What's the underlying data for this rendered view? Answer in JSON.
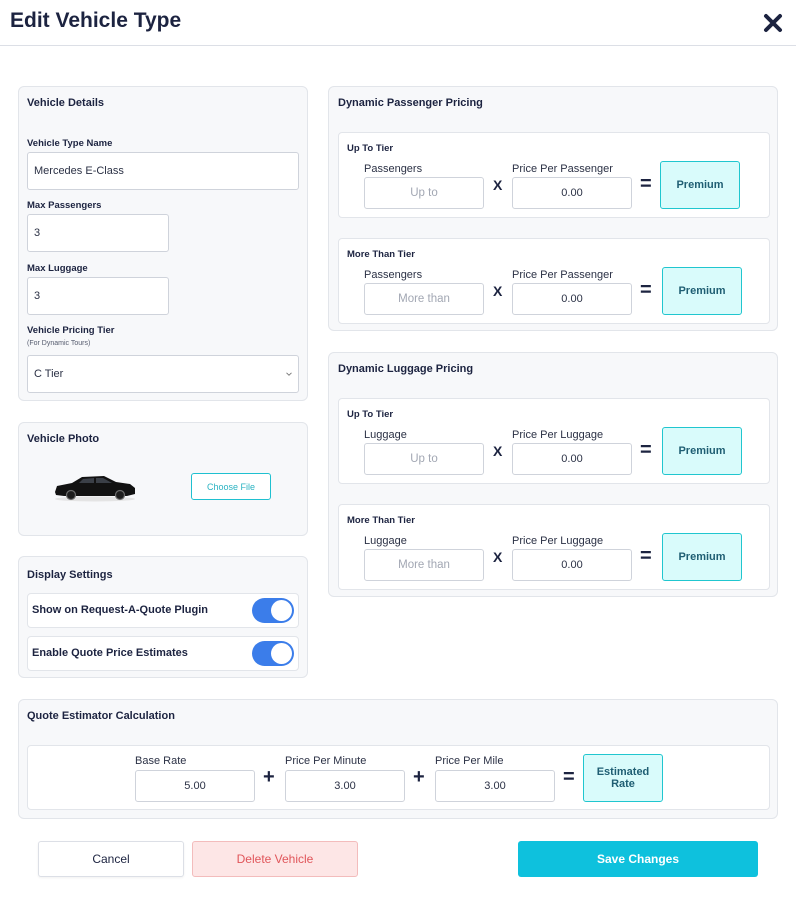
{
  "header": {
    "title": "Edit Vehicle Type",
    "close_icon": "close-icon"
  },
  "vehicle_details": {
    "title": "Vehicle Details",
    "type_name_label": "Vehicle Type Name",
    "type_name_value": "Mercedes E-Class",
    "max_passengers_label": "Max Passengers",
    "max_passengers_value": "3",
    "max_luggage_label": "Max Luggage",
    "max_luggage_value": "3",
    "pricing_tier_label": "Vehicle Pricing Tier",
    "pricing_tier_sublabel": "(For Dynamic Tours)",
    "pricing_tier_value": "C Tier"
  },
  "vehicle_photo": {
    "title": "Vehicle Photo",
    "choose_file_label": "Choose File"
  },
  "display_settings": {
    "title": "Display Settings",
    "toggles": [
      {
        "label": "Show on Request-A-Quote Plugin",
        "on": true
      },
      {
        "label": "Enable Quote Price Estimates",
        "on": true
      }
    ]
  },
  "passenger_pricing": {
    "title": "Dynamic Passenger Pricing",
    "up_to": {
      "title": "Up To Tier",
      "qty_label": "Passengers",
      "qty_placeholder": "Up to",
      "price_label": "Price Per Passenger",
      "price_value": "0.00",
      "times": "X",
      "equals": "=",
      "result_label": "Premium"
    },
    "more_than": {
      "title": "More Than Tier",
      "qty_label": "Passengers",
      "qty_placeholder": "More than",
      "price_label": "Price Per Passenger",
      "price_value": "0.00",
      "times": "X",
      "equals": "=",
      "result_label": "Premium"
    }
  },
  "luggage_pricing": {
    "title": "Dynamic Luggage Pricing",
    "up_to": {
      "title": "Up To Tier",
      "qty_label": "Luggage",
      "qty_placeholder": "Up to",
      "price_label": "Price Per Luggage",
      "price_value": "0.00",
      "times": "X",
      "equals": "=",
      "result_label": "Premium"
    },
    "more_than": {
      "title": "More Than Tier",
      "qty_label": "Luggage",
      "qty_placeholder": "More than",
      "price_label": "Price Per Luggage",
      "price_value": "0.00",
      "times": "X",
      "equals": "=",
      "result_label": "Premium"
    }
  },
  "quote_estimator": {
    "title": "Quote Estimator Calculation",
    "base_rate_label": "Base Rate",
    "base_rate_value": "5.00",
    "per_minute_label": "Price Per Minute",
    "per_minute_value": "3.00",
    "per_mile_label": "Price Per Mile",
    "per_mile_value": "3.00",
    "plus": "+",
    "equals": "=",
    "result_label": "Estimated Rate"
  },
  "footer": {
    "cancel_label": "Cancel",
    "delete_label": "Delete Vehicle",
    "save_label": "Save Changes"
  },
  "colors": {
    "accent": "#0ec1dd",
    "toggle_on": "#3b7dea",
    "premium_bg": "#d9fbfb",
    "danger": "#e0555a"
  }
}
